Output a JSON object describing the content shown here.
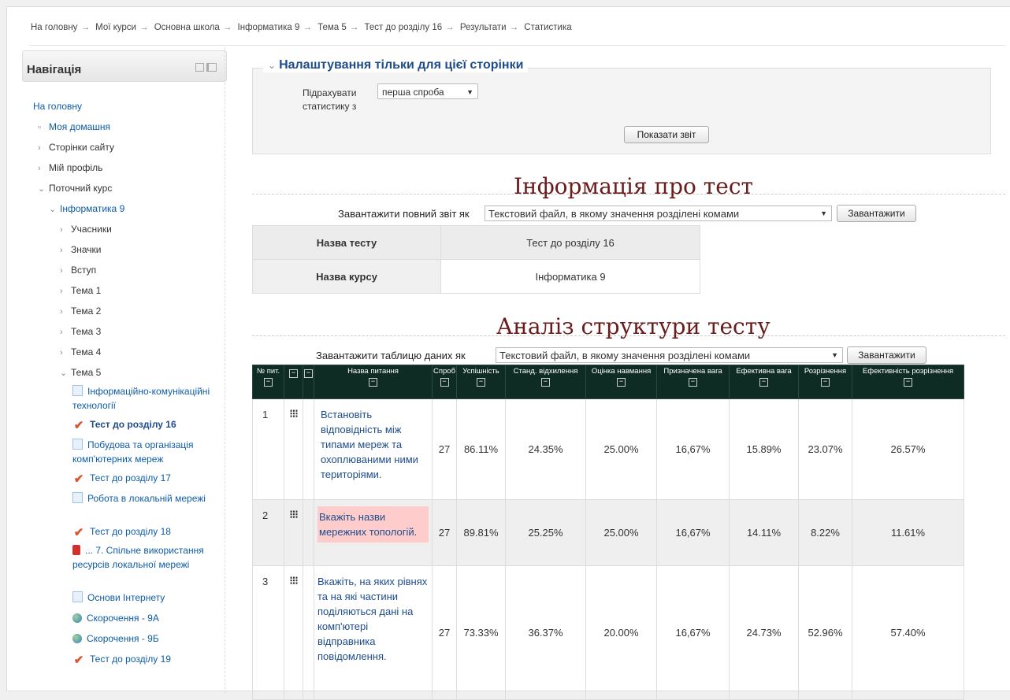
{
  "breadcrumbs": [
    "На головну",
    "Мої курси",
    "Основна школа",
    "Інформатика 9",
    "Тема 5",
    "Тест до розділу 16",
    "Результати",
    "Статистика"
  ],
  "breadcrumb_sep": "→",
  "nav": {
    "title": "Навігація",
    "items": [
      {
        "label": "На головну"
      },
      {
        "label": "Моя домашня"
      },
      {
        "label": "Сторінки сайту"
      },
      {
        "label": "Мій профіль"
      },
      {
        "label": "Поточний курс"
      },
      {
        "label": "Інформатика 9"
      },
      {
        "label": "Учасники"
      },
      {
        "label": "Значки"
      },
      {
        "label": "Вступ"
      },
      {
        "label": "Тема 1"
      },
      {
        "label": "Тема 2"
      },
      {
        "label": "Тема 3"
      },
      {
        "label": "Тема 4"
      },
      {
        "label": "Тема 5"
      },
      {
        "label": "Інформаційно-комунікаційні технології"
      },
      {
        "label": "Тест до розділу 16"
      },
      {
        "label": "Побудова та організація комп'ютерних мереж"
      },
      {
        "label": "Тест до розділу 17"
      },
      {
        "label": "Робота в локальній мережі"
      },
      {
        "label": "Тест до розділу 18"
      },
      {
        "label": "... 7. Спільне використання ресурсів локальної мережі"
      },
      {
        "label": "Основи Інтернету"
      },
      {
        "label": "Скорочення - 9А"
      },
      {
        "label": "Скорочення - 9Б"
      },
      {
        "label": "Тест до розділу 19"
      }
    ]
  },
  "settings": {
    "legend": "Налаштування тільки для цієї сторінки",
    "recalc_label": "Підрахувати статистику з",
    "attempt_value": "перша спроба",
    "show_report": "Показати звіт"
  },
  "quiz_info": {
    "heading": "Інформація про тест",
    "download_label": "Завантажити повний звіт як",
    "download_format": "Текстовий файл, в якому значення розділені комами",
    "download_button": "Завантажити",
    "rows": [
      {
        "key": "Назва тесту",
        "value": "Тест до розділу 16"
      },
      {
        "key": "Назва курсу",
        "value": "Інформатика 9"
      }
    ]
  },
  "structure": {
    "heading": "Аналіз структури тесту",
    "download_label": "Завантажити таблицю даних як",
    "download_format": "Текстовий файл, в якому значення розділені комами",
    "download_button": "Завантажити",
    "columns": [
      "№ пит.",
      "",
      "",
      "Назва питання",
      "Спроб",
      "Успішність",
      "Станд. відхилення",
      "Оцінка навмання",
      "Призначена вага",
      "Ефективна вага",
      "Розрізнення",
      "Ефективність розрізнення"
    ],
    "rows": [
      {
        "n": "1",
        "name": "Встановіть відповідність між типами мереж та охоплюваними ними територіями.",
        "attempts": "27",
        "facility": "86.11%",
        "sd": "24.35%",
        "guess": "25.00%",
        "intended": "16,67%",
        "effective": "15.89%",
        "disc": "23.07%",
        "disc_eff": "26.57%"
      },
      {
        "n": "2",
        "name": "Вкажіть назви мережних топологій.",
        "attempts": "27",
        "facility": "89.81%",
        "sd": "25.25%",
        "guess": "25.00%",
        "intended": "16,67%",
        "effective": "14.11%",
        "disc": "8.22%",
        "disc_eff": "11.61%"
      },
      {
        "n": "3",
        "name": "Вкажіть, на яких рівнях та на які частини поділяються дані на комп'ютері відправника повідомлення.",
        "attempts": "27",
        "facility": "73.33%",
        "sd": "36.37%",
        "guess": "20.00%",
        "intended": "16,67%",
        "effective": "24.73%",
        "disc": "52.96%",
        "disc_eff": "57.40%"
      }
    ]
  },
  "colors": {
    "header_bg": "#0e2b24",
    "link": "#0d5ca7",
    "heading": "#6a1b1b",
    "highlight": "#ffcccc"
  }
}
